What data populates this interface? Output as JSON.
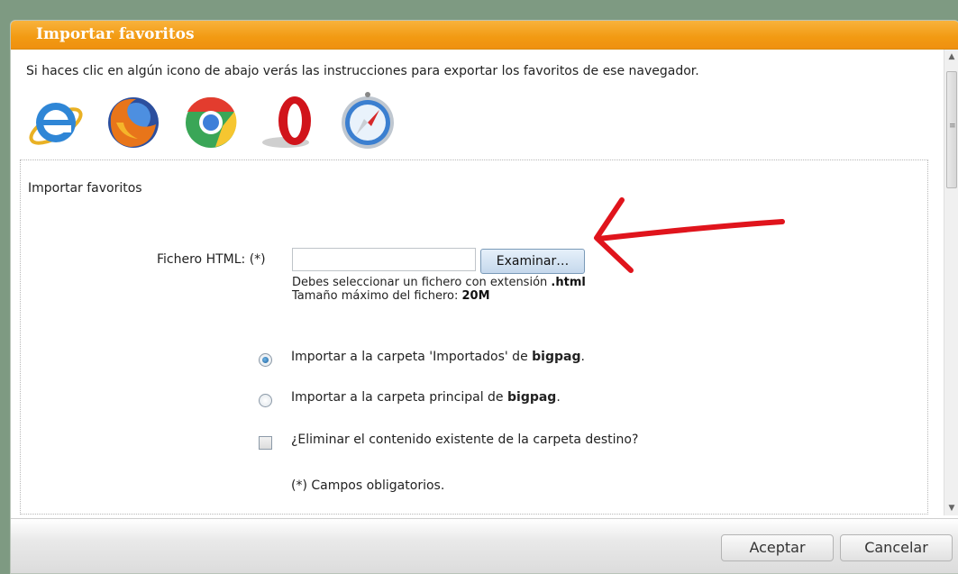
{
  "dialog": {
    "title": "Importar favoritos",
    "intro_text": "Si haces clic en algún icono de abajo verás las instrucciones para exportar los favoritos de ese navegador.",
    "browsers": [
      {
        "icon": "internet-explorer-icon"
      },
      {
        "icon": "firefox-icon"
      },
      {
        "icon": "chrome-icon"
      },
      {
        "icon": "opera-icon"
      },
      {
        "icon": "safari-icon"
      }
    ]
  },
  "import_section": {
    "legend": "Importar favoritos",
    "file_label": "Fichero HTML: (*)",
    "file_value": "",
    "browse_label": "Examinar…",
    "hint_prefix": "Debes seleccionar un fichero con extensión ",
    "hint_ext": ".html",
    "hint_size_prefix": "Tamaño máximo del fichero: ",
    "hint_size": "20M",
    "options": [
      {
        "prefix": "Importar a la carpeta 'Importados' de ",
        "bold": "bigpag",
        "suffix": ".",
        "checked": true
      },
      {
        "prefix": "Importar a la carpeta principal de ",
        "bold": "bigpag",
        "suffix": ".",
        "checked": false
      }
    ],
    "delete_existing_label": "¿Eliminar el contenido existente de la carpeta destino?",
    "delete_existing_checked": false,
    "required_note": "(*) Campos obligatorios."
  },
  "footer": {
    "accept_label": "Aceptar",
    "cancel_label": "Cancelar"
  },
  "colors": {
    "title_bar": "#f29a12",
    "annotation_arrow": "#e0141c"
  }
}
